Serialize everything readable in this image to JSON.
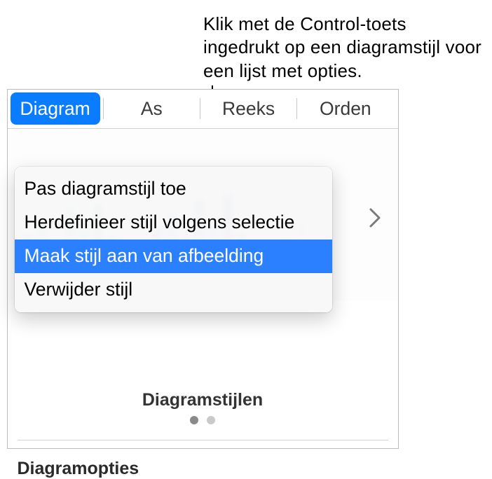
{
  "callout": {
    "text": "Klik met de Control-toets ingedrukt op een diagramstijl voor een lijst met opties."
  },
  "tabs": {
    "diagram": "Diagram",
    "as": "As",
    "reeks": "Reeks",
    "orden": "Orden"
  },
  "context_menu": {
    "items": [
      {
        "label": "Pas diagramstijl toe",
        "selected": false
      },
      {
        "label": "Herdefinieer stijl volgens selectie",
        "selected": false
      },
      {
        "label": "Maak stijl aan van afbeelding",
        "selected": true
      },
      {
        "label": "Verwijder stijl",
        "selected": false
      }
    ]
  },
  "sections": {
    "styles_label": "Diagramstijlen",
    "options_label": "Diagramopties"
  },
  "pager": {
    "page_count": 2,
    "active_index": 0
  }
}
